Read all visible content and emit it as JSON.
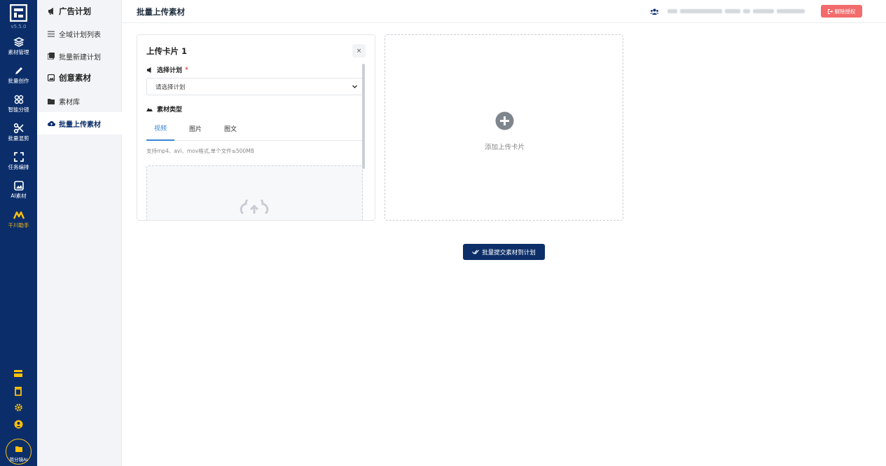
{
  "rail": {
    "version": "v5.5.0",
    "items": [
      {
        "label": "素材管理",
        "icon": "layers-icon"
      },
      {
        "label": "批量创作",
        "icon": "pencil-icon"
      },
      {
        "label": "智能分镜",
        "icon": "scissors-icon"
      },
      {
        "label": "批量混剪",
        "icon": "cut-icon"
      },
      {
        "label": "任务编排",
        "icon": "expand-icon"
      },
      {
        "label": "AI素材",
        "icon": "image-icon"
      },
      {
        "label": "千川助手",
        "icon": "m-logo-icon"
      }
    ],
    "bottom_icons": [
      "card-icon",
      "trash-icon",
      "gear-icon",
      "user-circle-icon"
    ],
    "user_label": "简分镜AI"
  },
  "sidebar": {
    "items": [
      {
        "label": "广告计划",
        "icon": "megaphone-icon"
      },
      {
        "label": "全域计划列表",
        "icon": "list-icon"
      },
      {
        "label": "批量新建计划",
        "icon": "copy-icon"
      },
      {
        "label": "创意素材",
        "icon": "picture-icon"
      },
      {
        "label": "素材库",
        "icon": "folder-icon"
      },
      {
        "label": "批量上传素材",
        "icon": "cloud-upload-icon"
      }
    ]
  },
  "header": {
    "title": "批量上传素材",
    "deauth_label": "解除授权"
  },
  "upload_card": {
    "title": "上传卡片 1",
    "close_label": "×",
    "plan_label": "选择计划",
    "required_mark": "*",
    "plan_placeholder": "请选择计划",
    "type_label": "素材类型",
    "tabs": [
      "视频",
      "图片",
      "图文"
    ],
    "active_tab": "视频",
    "hint": "支持mp4、avi、mov格式,单个文件≤500MB"
  },
  "add_card": {
    "label": "添加上传卡片"
  },
  "submit": {
    "label": "批量提交素材到计划"
  },
  "colors": {
    "rail_bg": "#0b2e6b",
    "accent_yellow": "#ffc107",
    "danger": "#f36b6b",
    "tab_active": "#3a86d6"
  }
}
